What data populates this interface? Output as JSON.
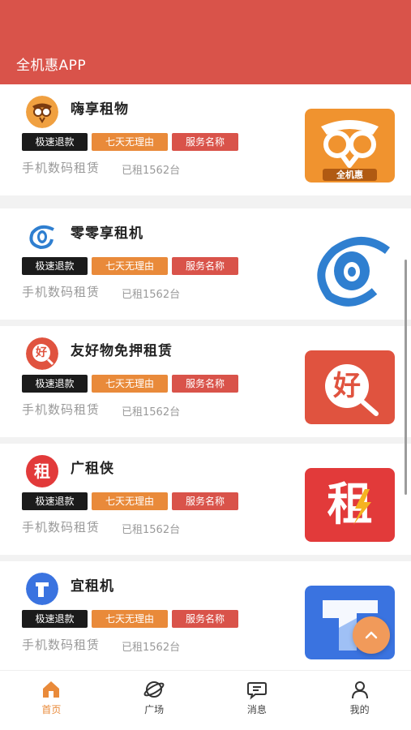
{
  "header": {
    "title": "全机惠APP"
  },
  "tags": {
    "fast_refund": "极速退款",
    "seven_day": "七天无理由",
    "service": "服务名称"
  },
  "items": [
    {
      "name": "嗨享租物",
      "desc": "手机数码租赁",
      "count": "已租1562台",
      "logo_icon": "owl-icon",
      "logo_text": "全机惠"
    },
    {
      "name": "零零享租机",
      "desc": "手机数码租赁",
      "count": "已租1562台",
      "logo_icon": "swirl-zero-icon"
    },
    {
      "name": "友好物免押租赁",
      "desc": "手机数码租赁",
      "count": "已租1562台",
      "logo_icon": "hao-magnifier-icon",
      "logo_char": "好"
    },
    {
      "name": "广租侠",
      "desc": "手机数码租赁",
      "count": "已租1562台",
      "logo_icon": "zu-lightning-icon",
      "logo_char": "租"
    },
    {
      "name": "宜租机",
      "desc": "手机数码租赁",
      "count": "已租1562台",
      "logo_icon": "blue-shape-icon"
    }
  ],
  "tabbar": [
    {
      "label": "首页",
      "icon": "home-icon",
      "active": true
    },
    {
      "label": "广场",
      "icon": "planet-icon",
      "active": false
    },
    {
      "label": "消息",
      "icon": "message-icon",
      "active": false
    },
    {
      "label": "我的",
      "icon": "user-icon",
      "active": false
    }
  ],
  "colors": {
    "brand": "#d9534a",
    "orange": "#e98a3a",
    "black_tag": "#1b1b1b"
  }
}
